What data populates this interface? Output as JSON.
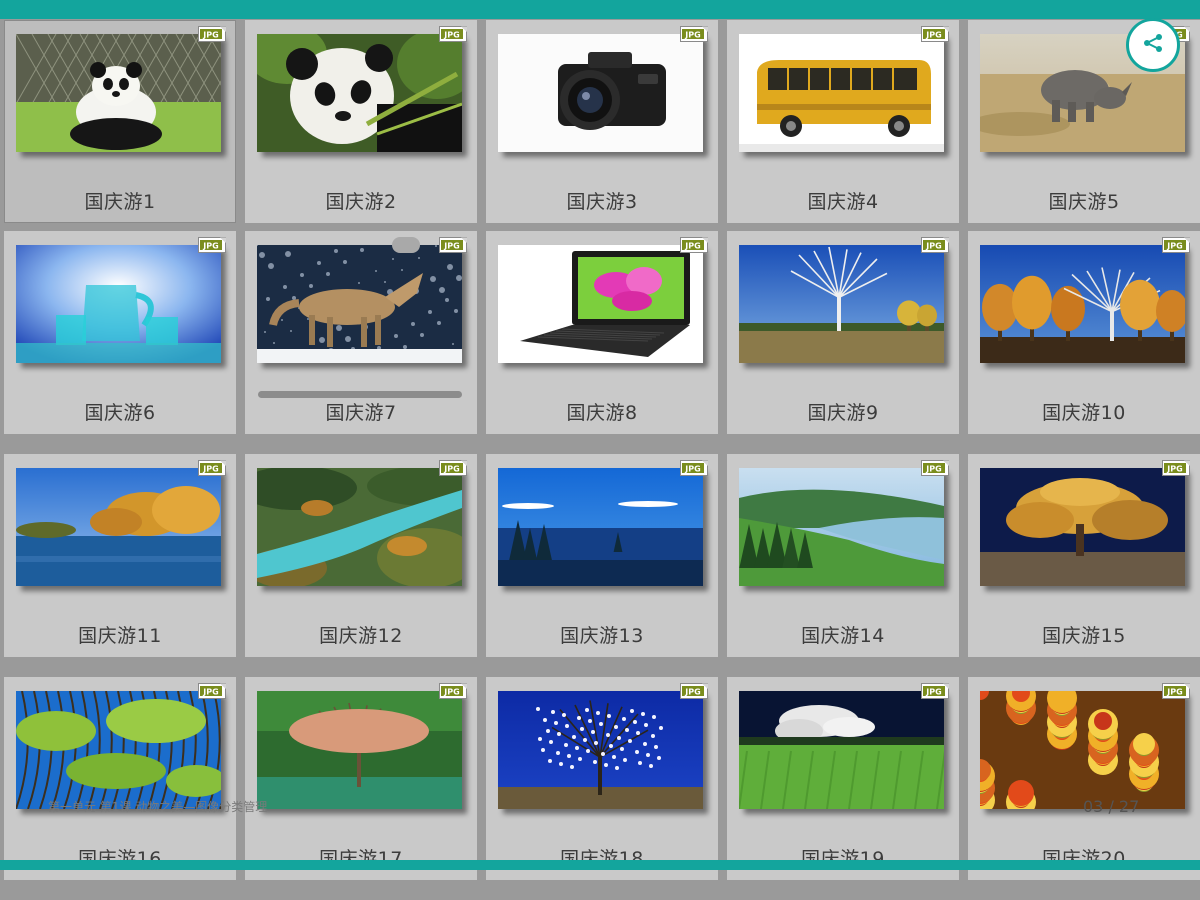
{
  "gallery": {
    "items": [
      {
        "label": "国庆游1",
        "badge": "JPG",
        "icon": "panda-photo"
      },
      {
        "label": "国庆游2",
        "badge": "JPG",
        "icon": "panda-closeup-photo"
      },
      {
        "label": "国庆游3",
        "badge": "JPG",
        "icon": "camera-photo"
      },
      {
        "label": "国庆游4",
        "badge": "JPG",
        "icon": "bus-photo"
      },
      {
        "label": "国庆游5",
        "badge": "JPG",
        "icon": "rhino-photo"
      },
      {
        "label": "国庆游6",
        "badge": "JPG",
        "icon": "glass-pitcher-photo"
      },
      {
        "label": "国庆游7",
        "badge": "JPG",
        "icon": "wolf-photo"
      },
      {
        "label": "国庆游8",
        "badge": "JPG",
        "icon": "laptop-photo"
      },
      {
        "label": "国庆游9",
        "badge": "JPG",
        "icon": "birch-tree-photo"
      },
      {
        "label": "国庆游10",
        "badge": "JPG",
        "icon": "autumn-trees-photo"
      },
      {
        "label": "国庆游11",
        "badge": "JPG",
        "icon": "autumn-river-photo"
      },
      {
        "label": "国庆游12",
        "badge": "JPG",
        "icon": "turquoise-river-photo"
      },
      {
        "label": "国庆游13",
        "badge": "JPG",
        "icon": "blue-lake-photo"
      },
      {
        "label": "国庆游14",
        "badge": "JPG",
        "icon": "green-valley-lake-photo"
      },
      {
        "label": "国庆游15",
        "badge": "JPG",
        "icon": "golden-tree-photo"
      },
      {
        "label": "国庆游16",
        "badge": "JPG",
        "icon": "willow-canopy-photo"
      },
      {
        "label": "国庆游17",
        "badge": "JPG",
        "icon": "lakeside-tree-photo"
      },
      {
        "label": "国庆游18",
        "badge": "JPG",
        "icon": "blossom-tree-photo"
      },
      {
        "label": "国庆游19",
        "badge": "JPG",
        "icon": "meadow-tree-photo"
      },
      {
        "label": "国庆游20",
        "badge": "JPG",
        "icon": "autumn-forest-photo"
      }
    ]
  },
  "footer": {
    "caption": "第一单元 第1课 动物之美—图像分类管理",
    "page_counter": "03 / 27"
  },
  "nav": {
    "icon": "share-nodes-icon"
  },
  "colors": {
    "accent": "#13a59d",
    "tile_bg": "#c9c9c9",
    "background": "#9a9a9a",
    "badge": "#7f8f1f"
  }
}
